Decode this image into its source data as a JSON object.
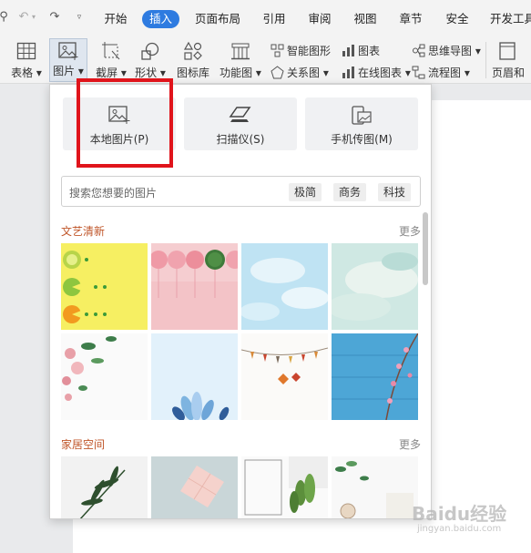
{
  "menubar": {
    "tabs": [
      "开始",
      "插入",
      "页面布局",
      "引用",
      "审阅",
      "视图",
      "章节",
      "安全",
      "开发工具"
    ],
    "active_tab": "插入",
    "accent": "#2e7be0"
  },
  "ribbon": {
    "table_label": "表格",
    "picture_label": "图片",
    "screenshot_label": "截屏",
    "shape_label": "形状",
    "iconlib_label": "图标库",
    "funcchart_label": "功能图",
    "smartshape_label": "智能图形",
    "relation_label": "关系图",
    "chart_label": "图表",
    "onlinechart_label": "在线图表",
    "mindmap_label": "思维导图",
    "flowchart_label": "流程图",
    "header_label": "页眉和"
  },
  "panel": {
    "sources": [
      {
        "label": "本地图片(P)",
        "icon": "local-image-icon"
      },
      {
        "label": "扫描仪(S)",
        "icon": "scanner-icon"
      },
      {
        "label": "手机传图(M)",
        "icon": "phone-image-icon"
      }
    ],
    "search_placeholder": "搜索您想要的图片",
    "search_tags": [
      "极简",
      "商务",
      "科技"
    ],
    "sections": [
      {
        "title": "文艺清新",
        "more": "更多"
      },
      {
        "title": "家居空间",
        "more": "更多"
      }
    ],
    "highlight_color": "#e0141b"
  },
  "watermark": {
    "text": "Baidu经验",
    "sub": "jingyan.baidu.com"
  }
}
